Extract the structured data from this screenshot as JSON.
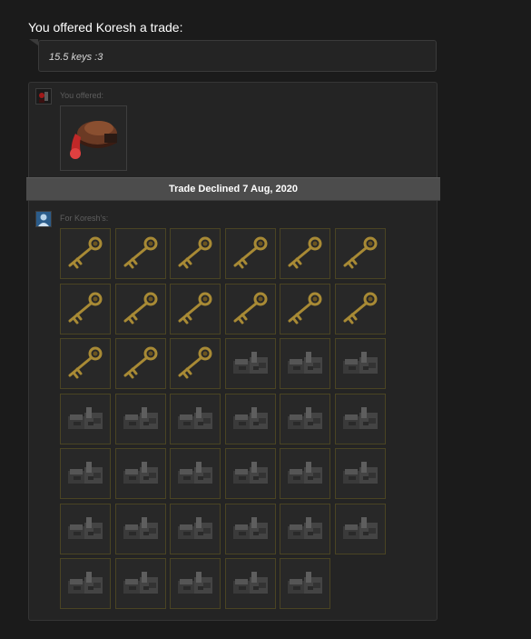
{
  "header": {
    "title": "You offered Koresh a trade:"
  },
  "message": {
    "text": "15.5 keys :3"
  },
  "offer": {
    "you_label": "You offered:",
    "you_items": [
      {
        "name": "hat-item"
      }
    ],
    "them_label": "For Koresh's:",
    "them_items": [
      "key",
      "key",
      "key",
      "key",
      "key",
      "key",
      "key",
      "key",
      "key",
      "key",
      "key",
      "key",
      "key",
      "key",
      "key",
      "metal",
      "metal",
      "metal",
      "metal",
      "metal",
      "metal",
      "metal",
      "metal",
      "metal",
      "metal",
      "metal",
      "metal",
      "metal",
      "metal",
      "metal",
      "metal",
      "metal",
      "metal",
      "metal",
      "metal",
      "metal",
      "metal",
      "metal",
      "metal",
      "metal",
      "metal"
    ]
  },
  "status": {
    "text": "Trade Declined 7 Aug, 2020"
  },
  "colors": {
    "background": "#1b1b1b",
    "panel": "#242424",
    "slot_border": "#4a4423",
    "status_bar": "#4c4c4c",
    "key_gold": "#a88a35"
  }
}
